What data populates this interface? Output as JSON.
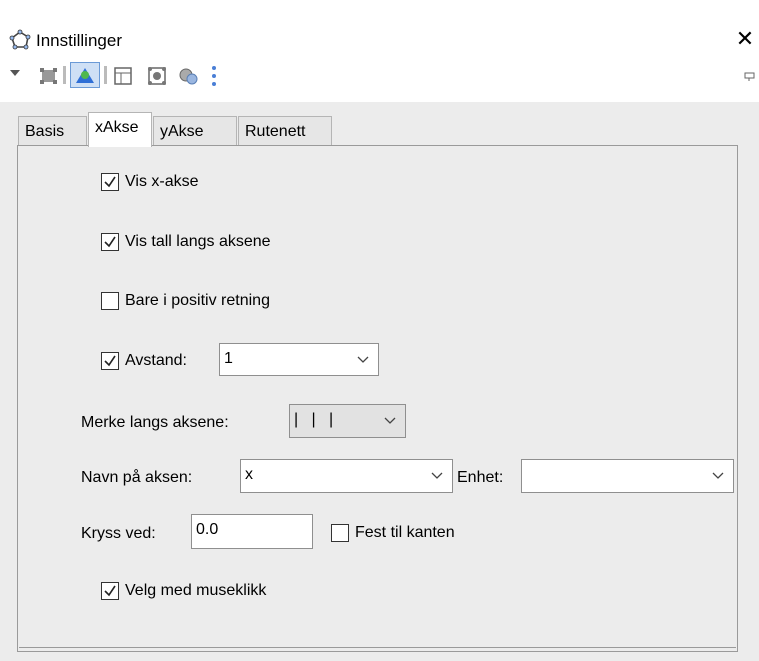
{
  "window": {
    "title": "Innstillinger"
  },
  "tabs": [
    {
      "label": "Basis",
      "active": false
    },
    {
      "label": "xAkse",
      "active": true
    },
    {
      "label": "yAkse",
      "active": false
    },
    {
      "label": "Rutenett",
      "active": false
    }
  ],
  "xaxis": {
    "show_axis": {
      "label": "Vis x-akse",
      "checked": true
    },
    "show_numbers": {
      "label": "Vis tall langs aksene",
      "checked": true
    },
    "positive_only": {
      "label": "Bare i positiv retning",
      "checked": false
    },
    "distance": {
      "label": "Avstand:",
      "checked": true,
      "value": "1"
    },
    "ticks": {
      "label": "Merke langs aksene:",
      "value": "|   |   |"
    },
    "axis_name": {
      "label": "Navn på aksen:",
      "value": "x"
    },
    "unit": {
      "label": "Enhet:",
      "value": ""
    },
    "cross_at": {
      "label": "Kryss ved:",
      "value": "0.0"
    },
    "fix_to_edge": {
      "label": "Fest til kanten",
      "checked": false
    },
    "select_with_click": {
      "label": "Velg med museklikk",
      "checked": true
    }
  },
  "colors": {
    "panel_bg": "#ececec",
    "tab_active": "#ffffff",
    "accent_blue": "#2f6fd6"
  }
}
